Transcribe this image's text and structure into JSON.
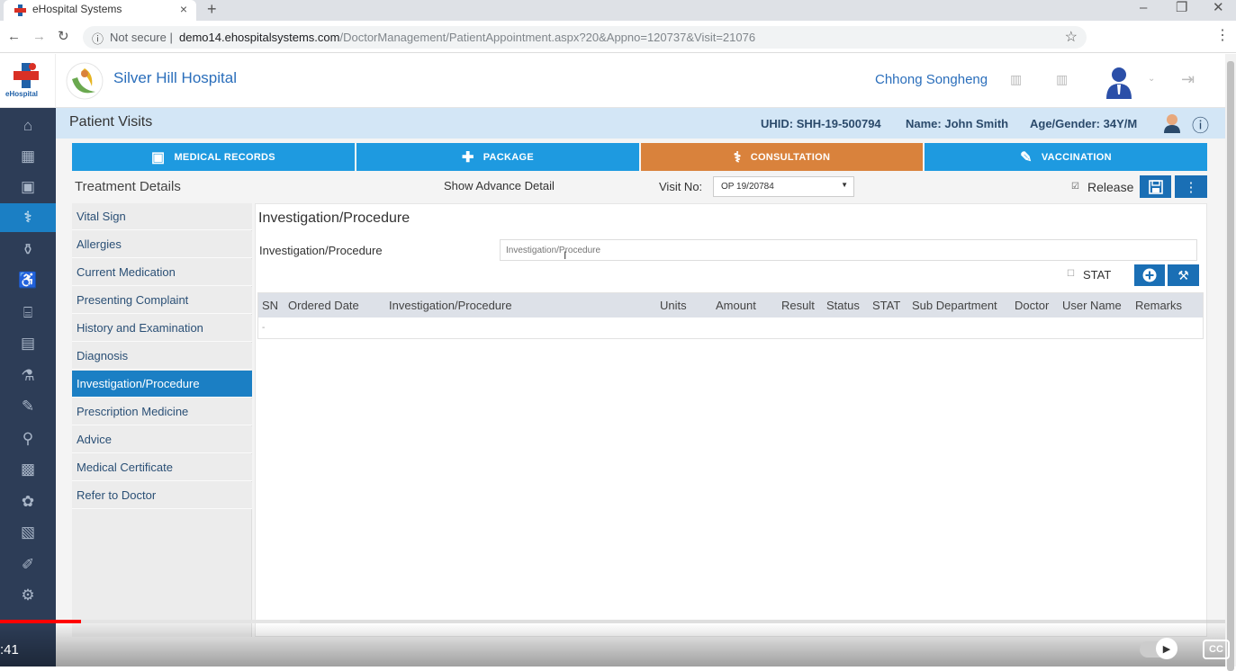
{
  "browser": {
    "tab_title": "eHospital Systems",
    "close": "×",
    "new_tab": "+",
    "url_prefix": "Not secure",
    "url_host": "demo14.ehospitalsystems.com",
    "url_path": "/DoctorManagement/PatientAppointment.aspx?20&Appno=120737&Visit=21076"
  },
  "header": {
    "ehospital_logo_text": "eHospital",
    "hospital_name": "Silver Hill Hospital",
    "user_name": "Chhong Songheng"
  },
  "patient_bar": {
    "title": "Patient Visits",
    "uhid": "UHID: SHH-19-500794",
    "name": "Name: John Smith",
    "age_gender": "Age/Gender: 34Y/M"
  },
  "main_tabs": [
    {
      "label": "MEDICAL RECORDS"
    },
    {
      "label": "PACKAGE"
    },
    {
      "label": "CONSULTATION"
    },
    {
      "label": "VACCINATION"
    }
  ],
  "treatment": {
    "title": "Treatment Details",
    "show_advance": "Show Advance Detail",
    "visit_label": "Visit No:",
    "visit_value": "OP 19/20784",
    "release_label": "Release"
  },
  "left_menu": [
    {
      "label": "Vital Sign"
    },
    {
      "label": "Allergies"
    },
    {
      "label": "Current Medication"
    },
    {
      "label": "Presenting Complaint"
    },
    {
      "label": "History and Examination"
    },
    {
      "label": "Diagnosis"
    },
    {
      "label": "Investigation/Procedure"
    },
    {
      "label": "Prescription Medicine"
    },
    {
      "label": "Advice"
    },
    {
      "label": "Medical Certificate"
    },
    {
      "label": "Refer to Doctor"
    }
  ],
  "panel": {
    "title": "Investigation/Procedure",
    "field_label": "Investigation/Procedure",
    "field_placeholder": "Investigation/Procedure",
    "stat_label": "STAT",
    "columns": [
      "SN",
      "Ordered Date",
      "Investigation/Procedure",
      "Units",
      "Amount",
      "Result",
      "Status",
      "STAT",
      "Sub Department",
      "Doctor",
      "User Name",
      "Remarks"
    ],
    "empty_cell": "-"
  },
  "video": {
    "time": ":41",
    "cc": "CC",
    "progress": 0.066,
    "buffered": 0.245
  }
}
